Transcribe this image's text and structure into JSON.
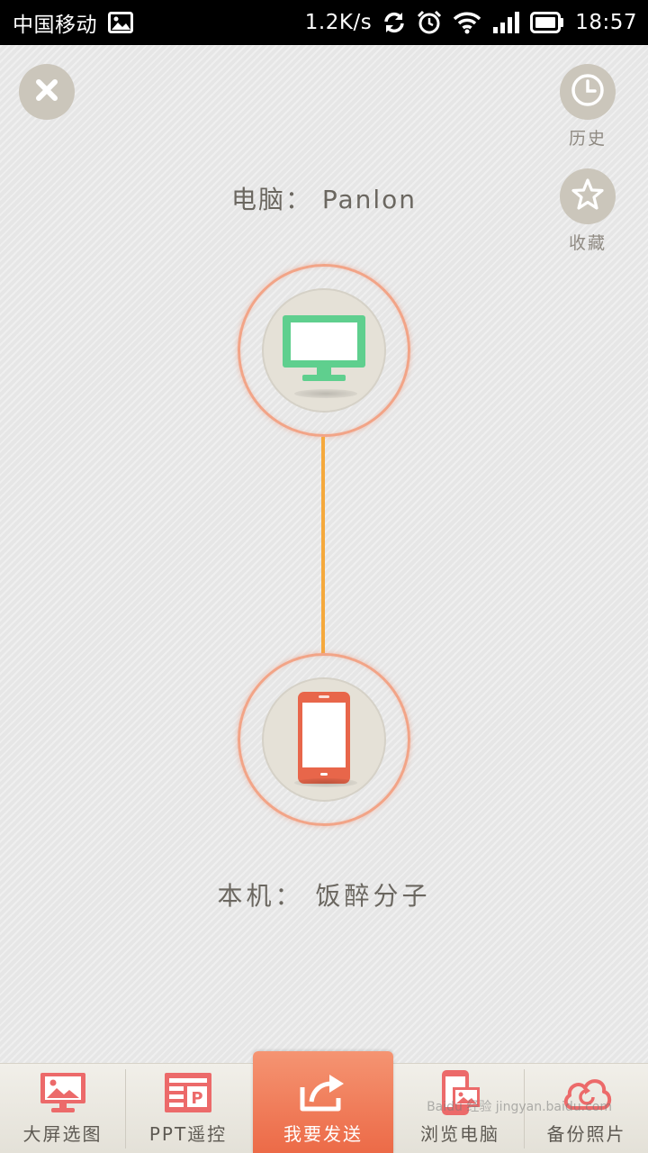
{
  "status_bar": {
    "carrier": "中国移动",
    "speed": "1.2K/s",
    "time": "18:57",
    "icons": [
      "image-icon",
      "sync-icon",
      "alarm-icon",
      "wifi-icon",
      "signal-icon",
      "battery-icon"
    ]
  },
  "top": {
    "close_icon": "close-icon",
    "history_label": "历史",
    "favorites_label": "收藏"
  },
  "connection": {
    "pc_label": "电脑： Panlon",
    "self_label": "本机： 饭醉分子",
    "pc_icon": "monitor-icon",
    "phone_icon": "phone-icon",
    "line_color": "#f5a93c"
  },
  "tabs": [
    {
      "label": "大屏选图",
      "icon": "picture-screen-icon"
    },
    {
      "label": "PPT遥控",
      "icon": "ppt-icon"
    },
    {
      "label": "我要发送",
      "icon": "send-icon",
      "active": true
    },
    {
      "label": "浏览电脑",
      "icon": "browse-pc-icon"
    },
    {
      "label": "备份照片",
      "icon": "cloud-backup-icon"
    }
  ],
  "watermark": "Baidu 经验 jingyan.baidu.com",
  "colors": {
    "accent": "#ec6a47",
    "monitor": "#5fcf8e",
    "phone": "#e8664a"
  }
}
